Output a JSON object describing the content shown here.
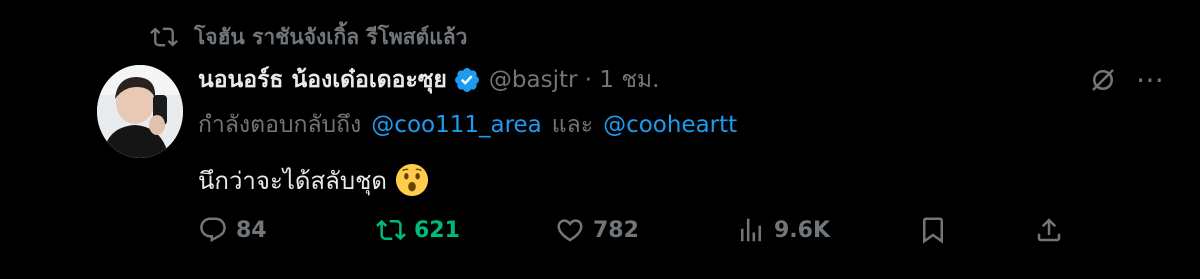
{
  "retweet_notice": {
    "icon": "retweet-icon",
    "text": "โจฮัน ราชันจังเกิ้ล รีโพสต์แล้ว"
  },
  "author": {
    "display_name": "นอนอร์ธ น้องเด๋อเดอะซุย",
    "verified_icon": "verified-badge-icon",
    "handle_time": "@basjtr · 1 ชม."
  },
  "reply_context": {
    "prefix": "กำลังตอบกลับถึง",
    "mention_1": "@coo111_area",
    "joiner": "และ",
    "mention_2": "@cooheartt"
  },
  "tweet": {
    "text": "นึกว่าจะได้สลับชุด",
    "emoji": "hushed-face-emoji"
  },
  "actions": {
    "replies": "84",
    "reposts": "621",
    "likes": "782",
    "views": "9.6K"
  },
  "colors": {
    "background": "#000000",
    "text": "#e7e9ea",
    "muted": "#71767b",
    "link": "#1d9bf0",
    "repost_active": "#00ba7c"
  }
}
